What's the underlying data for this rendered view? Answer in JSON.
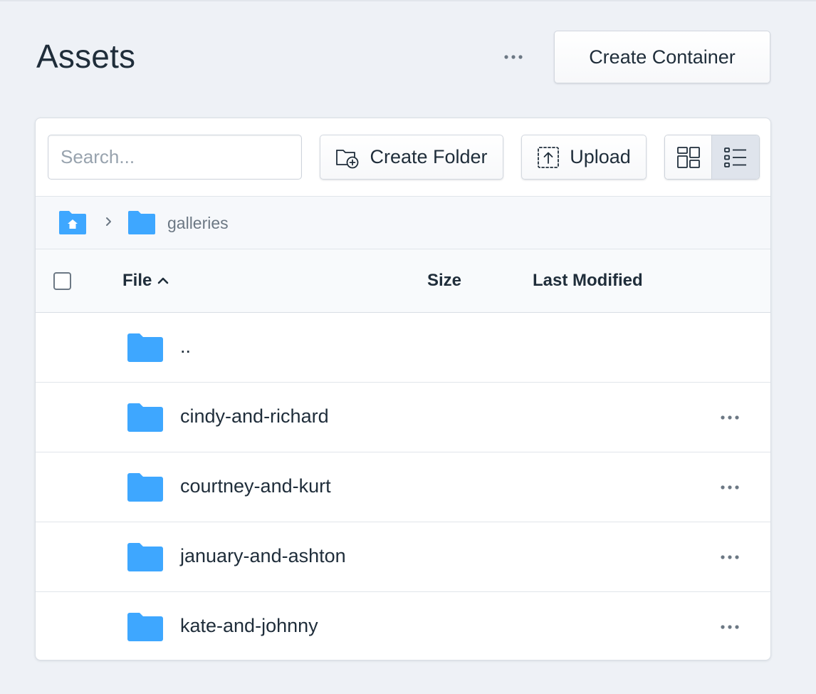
{
  "header": {
    "title": "Assets",
    "more_icon": "ellipsis-icon",
    "create_container_label": "Create Container"
  },
  "toolbar": {
    "search_placeholder": "Search...",
    "create_folder_label": "Create Folder",
    "upload_label": "Upload",
    "view_modes": [
      "grid",
      "list"
    ],
    "active_view": "list"
  },
  "breadcrumb": {
    "home_icon": "folder-home-icon",
    "current": "galleries"
  },
  "table": {
    "columns": {
      "file": "File",
      "size": "Size",
      "modified": "Last Modified"
    },
    "sort": {
      "column": "file",
      "direction": "ascending"
    },
    "rows": [
      {
        "name": "..",
        "type": "parent",
        "has_actions": false
      },
      {
        "name": "cindy-and-richard",
        "type": "folder",
        "has_actions": true
      },
      {
        "name": "courtney-and-kurt",
        "type": "folder",
        "has_actions": true
      },
      {
        "name": "january-and-ashton",
        "type": "folder",
        "has_actions": true
      },
      {
        "name": "kate-and-johnny",
        "type": "folder",
        "has_actions": true
      }
    ]
  },
  "colors": {
    "background": "#eef1f6",
    "folder": "#3ea7ff",
    "text": "#1f2d3a",
    "muted": "#6c7884",
    "active_toggle": "#dfe4ec"
  }
}
